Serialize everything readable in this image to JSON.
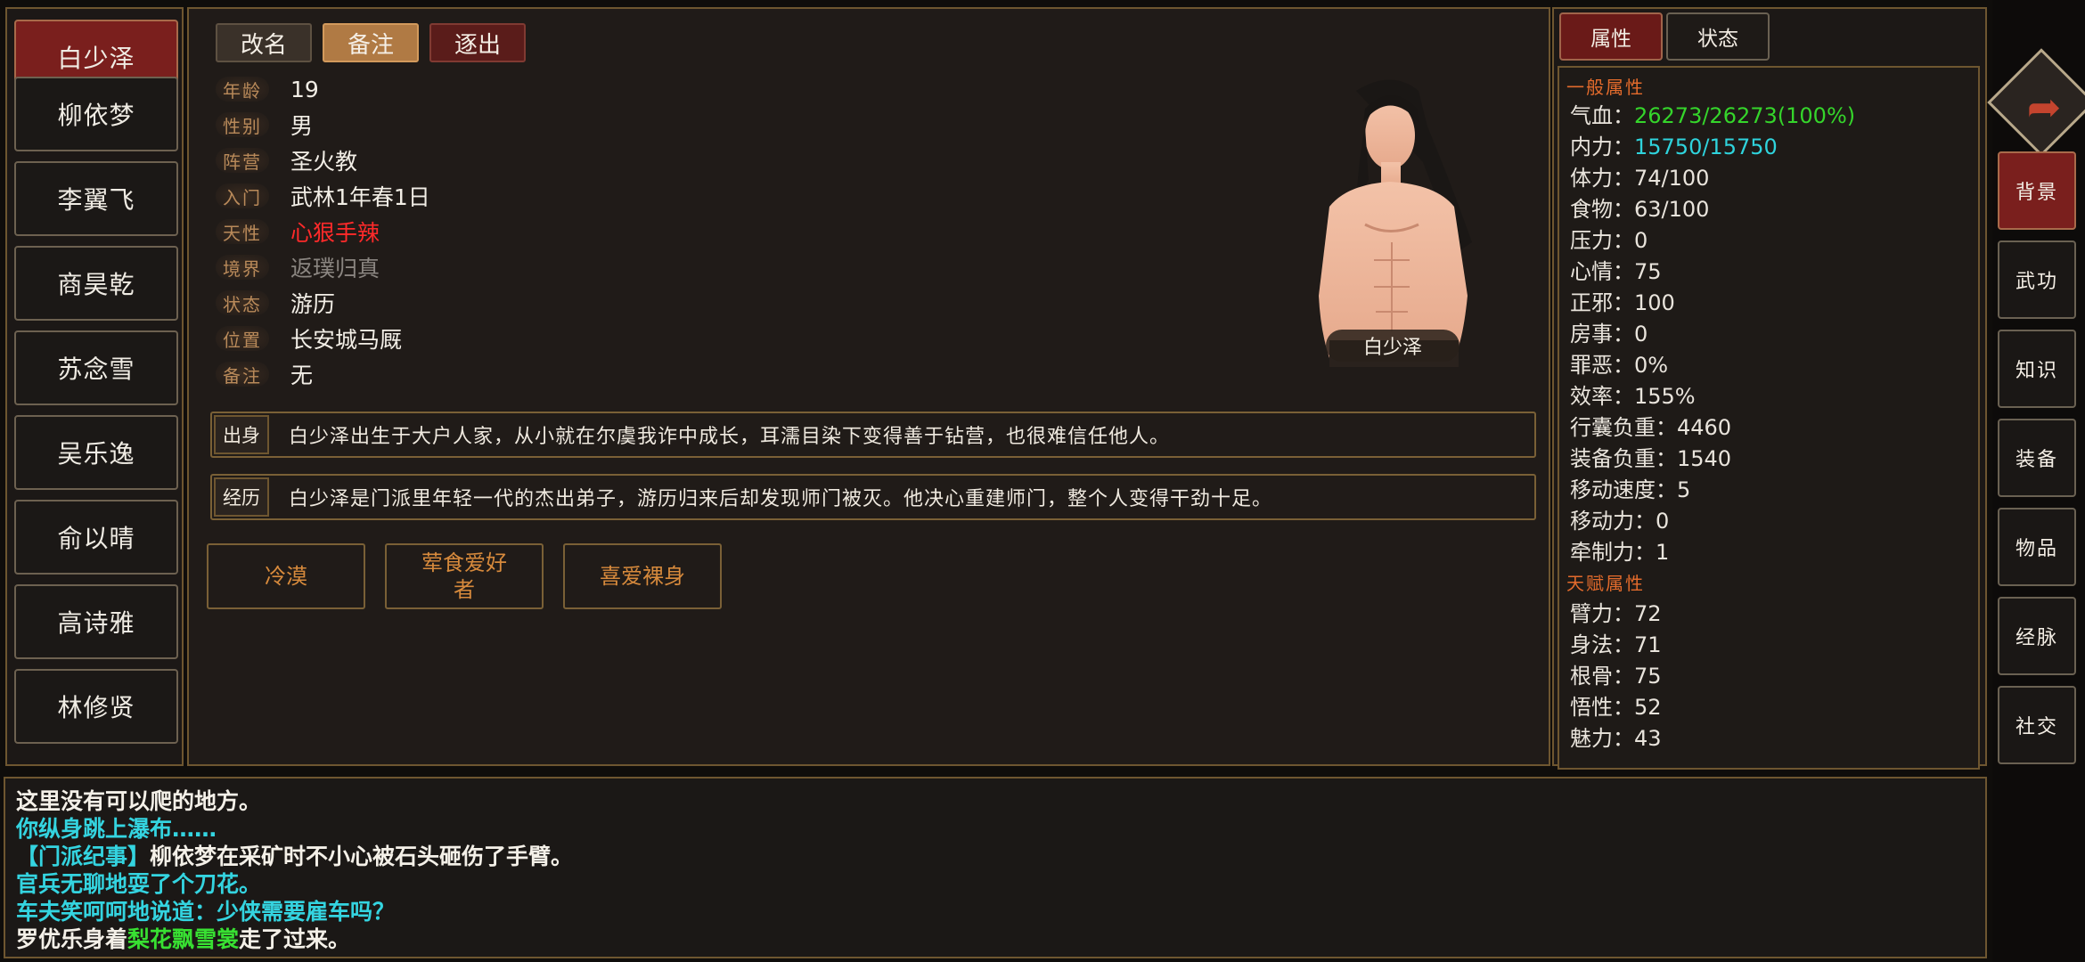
{
  "roster": [
    {
      "name": "白少泽",
      "active": true
    },
    {
      "name": "柳依梦",
      "active": false
    },
    {
      "name": "李翼飞",
      "active": false
    },
    {
      "name": "商昊乾",
      "active": false
    },
    {
      "name": "苏念雪",
      "active": false
    },
    {
      "name": "吴乐逸",
      "active": false
    },
    {
      "name": "俞以晴",
      "active": false
    },
    {
      "name": "高诗雅",
      "active": false
    },
    {
      "name": "林修贤",
      "active": false
    }
  ],
  "actions": {
    "rename": "改名",
    "remark": "备注",
    "expel": "逐出"
  },
  "profile": {
    "fields": [
      {
        "label": "年龄",
        "value": "19",
        "style": ""
      },
      {
        "label": "性别",
        "value": "男",
        "style": ""
      },
      {
        "label": "阵营",
        "value": "圣火教",
        "style": ""
      },
      {
        "label": "入门",
        "value": "武林1年春1日",
        "style": ""
      },
      {
        "label": "天性",
        "value": "心狠手辣",
        "style": "red"
      },
      {
        "label": "境界",
        "value": "返璞归真",
        "style": "grey"
      },
      {
        "label": "状态",
        "value": "游历",
        "style": ""
      },
      {
        "label": "位置",
        "value": "长安城马厩",
        "style": ""
      },
      {
        "label": "备注",
        "value": "无",
        "style": ""
      }
    ],
    "portrait_name": "白少泽",
    "origin_label": "出身",
    "origin_text": "白少泽出生于大户人家，从小就在尔虞我诈中成长，耳濡目染下变得善于钻营，也很难信任他人。",
    "history_label": "经历",
    "history_text": "白少泽是门派里年轻一代的杰出弟子，游历归来后却发现师门被灭。他决心重建师门，整个人变得干劲十足。",
    "traits": [
      "冷漠",
      "荤食爱好者",
      "喜爱裸身"
    ]
  },
  "tabs": {
    "attributes": "属性",
    "status": "状态"
  },
  "stats": {
    "general_title": "一般属性",
    "general": [
      {
        "label": "气血：",
        "value": "26273/26273(100%)",
        "color": "green"
      },
      {
        "label": "内力：",
        "value": "15750/15750",
        "color": "cyan"
      },
      {
        "label": "体力：",
        "value": "74/100",
        "color": ""
      },
      {
        "label": "食物：",
        "value": "63/100",
        "color": ""
      },
      {
        "label": "压力：",
        "value": "0",
        "color": ""
      },
      {
        "label": "心情：",
        "value": "75",
        "color": ""
      },
      {
        "label": "正邪：",
        "value": "100",
        "color": ""
      },
      {
        "label": "房事：",
        "value": "0",
        "color": ""
      },
      {
        "label": "罪恶：",
        "value": "0%",
        "color": ""
      },
      {
        "label": "效率：",
        "value": "155%",
        "color": ""
      },
      {
        "label": "行囊负重：",
        "value": "4460",
        "color": ""
      },
      {
        "label": "装备负重：",
        "value": "1540",
        "color": ""
      },
      {
        "label": "移动速度：",
        "value": "5",
        "color": ""
      },
      {
        "label": "移动力：",
        "value": "0",
        "color": ""
      },
      {
        "label": "牵制力：",
        "value": "1",
        "color": ""
      }
    ],
    "talent_title": "天赋属性",
    "talent": [
      {
        "label": "臂力：",
        "value": "72"
      },
      {
        "label": "身法：",
        "value": "71"
      },
      {
        "label": "根骨：",
        "value": "75"
      },
      {
        "label": "悟性：",
        "value": "52"
      },
      {
        "label": "魅力：",
        "value": "43"
      }
    ]
  },
  "nav": [
    {
      "label": "背景",
      "active": true
    },
    {
      "label": "武功",
      "active": false
    },
    {
      "label": "知识",
      "active": false
    },
    {
      "label": "装备",
      "active": false
    },
    {
      "label": "物品",
      "active": false
    },
    {
      "label": "经脉",
      "active": false
    },
    {
      "label": "社交",
      "active": false
    }
  ],
  "log": [
    {
      "parts": [
        {
          "text": "这里没有可以爬的地方。",
          "color": "white"
        }
      ]
    },
    {
      "parts": [
        {
          "text": "你纵身跳上瀑布……",
          "color": "cyan"
        }
      ]
    },
    {
      "parts": [
        {
          "text": "【门派纪事】",
          "color": "cyan"
        },
        {
          "text": "柳依梦在采矿时不小心被石头砸伤了手臂。",
          "color": "white"
        }
      ]
    },
    {
      "parts": [
        {
          "text": "官兵无聊地耍了个刀花。",
          "color": "cyan"
        }
      ]
    },
    {
      "parts": [
        {
          "text": "车夫笑呵呵地说道：少侠需要雇车吗？",
          "color": "cyan"
        }
      ]
    },
    {
      "parts": [
        {
          "text": "罗优乐身着",
          "color": "white"
        },
        {
          "text": "梨花飘雪裳",
          "color": "green"
        },
        {
          "text": "走了过来。",
          "color": "white"
        }
      ]
    }
  ],
  "colors": {
    "accent_red": "#7a1f1d",
    "border_gold": "#7a6036",
    "hp_green": "#35d52b",
    "mp_cyan": "#2fd3dc",
    "trait_orange": "#d78a3c"
  }
}
